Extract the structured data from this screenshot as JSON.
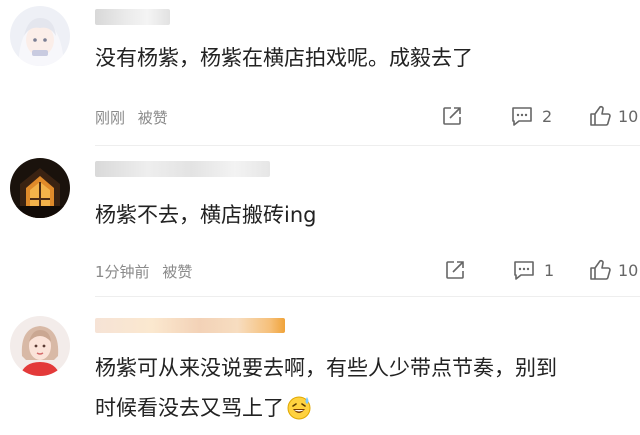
{
  "comments": [
    {
      "text": "没有杨紫，杨紫在横店拍戏呢。成毅去了",
      "time": "刚刚",
      "liked_label": "被赞",
      "comment_count": "2",
      "like_count": "10",
      "avatar": "anime-girl-avatar"
    },
    {
      "text": "杨紫不去，横店搬砖ing",
      "time": "1分钟前",
      "liked_label": "被赞",
      "comment_count": "1",
      "like_count": "10",
      "avatar": "window-night-avatar"
    },
    {
      "text_line1": "杨紫可从来没说要去啊，有些人少带点节奏，别到",
      "text_line2": "时候看没去又骂上了",
      "emoji": "grinning-sweat-emoji",
      "avatar": "woman-photo-avatar"
    }
  ],
  "icons": {
    "share": "share-icon",
    "comment": "comment-icon",
    "like": "thumbs-up-icon"
  },
  "colors": {
    "meta_text": "#8a8a8a",
    "body_text": "#222222",
    "icon": "#666666"
  }
}
